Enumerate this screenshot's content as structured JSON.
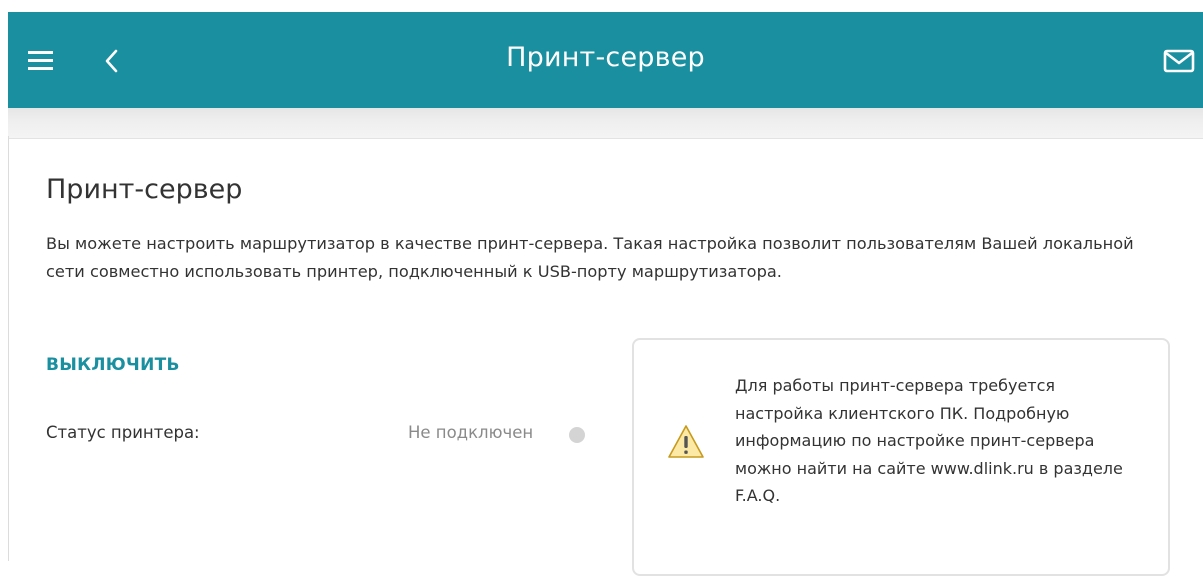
{
  "header": {
    "title": "Принт-сервер",
    "menu_icon": "hamburger-menu-icon",
    "back_icon": "chevron-left-icon",
    "mail_icon": "envelope-icon",
    "background_color": "#1a8fa0"
  },
  "page": {
    "title": "Принт-сервер",
    "description": "Вы можете настроить маршрутизатор в качестве принт-сервера. Такая настройка позволит пользователям Вашей локальной сети совместно использовать принтер, подключенный к USB-порту маршрутизатора.",
    "disable_label": "ВЫКЛЮЧИТЬ",
    "accent_color": "#1a8fa0"
  },
  "status": {
    "label": "Статус принтера:",
    "value": "Не подключен",
    "indicator_color": "#d4d4d4"
  },
  "info": {
    "icon": "warning-triangle-icon",
    "text": "Для работы принт-сервера требуется настройка клиентского ПК. Подробную информацию по настройке принт-сервера можно найти на сайте www.dlink.ru в разделе F.A.Q."
  }
}
